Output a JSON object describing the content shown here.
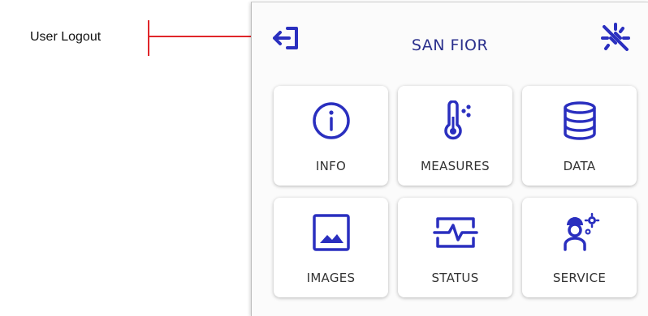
{
  "annotation": {
    "label": "User Logout"
  },
  "header": {
    "title": "SAN FIOR",
    "logout_icon": "logout-icon",
    "tool_icon": "disconnected-plug-icon"
  },
  "tiles": [
    {
      "label": "INFO",
      "icon": "info-icon"
    },
    {
      "label": "MEASURES",
      "icon": "thermometer-icon"
    },
    {
      "label": "DATA",
      "icon": "database-icon"
    },
    {
      "label": "IMAGES",
      "icon": "image-icon"
    },
    {
      "label": "STATUS",
      "icon": "status-pulse-icon"
    },
    {
      "label": "SERVICE",
      "icon": "service-technician-icon"
    }
  ],
  "colors": {
    "accent": "#2a2fbf",
    "annotation": "#e0262a"
  }
}
